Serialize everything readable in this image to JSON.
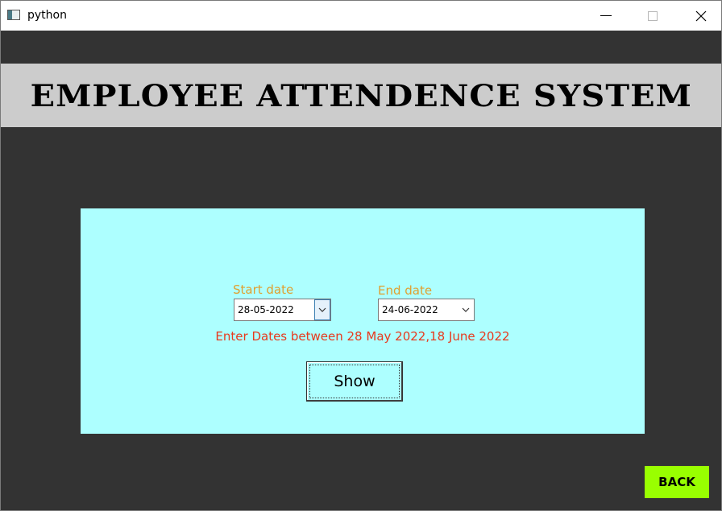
{
  "window": {
    "title": "python",
    "icon": "tkinter-window-icon",
    "controls": {
      "minimize_icon": "minimize-icon",
      "maximize_icon": "maximize-icon",
      "close_icon": "close-icon"
    }
  },
  "header": {
    "title": "EMPLOYEE ATTENDENCE SYSTEM"
  },
  "form": {
    "start_date": {
      "label": "Start date",
      "value": "28-05-2022",
      "dropdown_icon": "chevron-down-icon"
    },
    "end_date": {
      "label": "End date",
      "value": "24-06-2022",
      "dropdown_icon": "chevron-down-icon"
    },
    "hint": "Enter Dates between 28 May 2022,18 June 2022",
    "show_label": "Show"
  },
  "footer": {
    "back_label": "BACK"
  },
  "colors": {
    "background": "#333333",
    "header_band": "#cccccc",
    "panel": "#adffff",
    "label": "#e0a030",
    "hint": "#e8391d",
    "back_button": "#99ff00"
  }
}
